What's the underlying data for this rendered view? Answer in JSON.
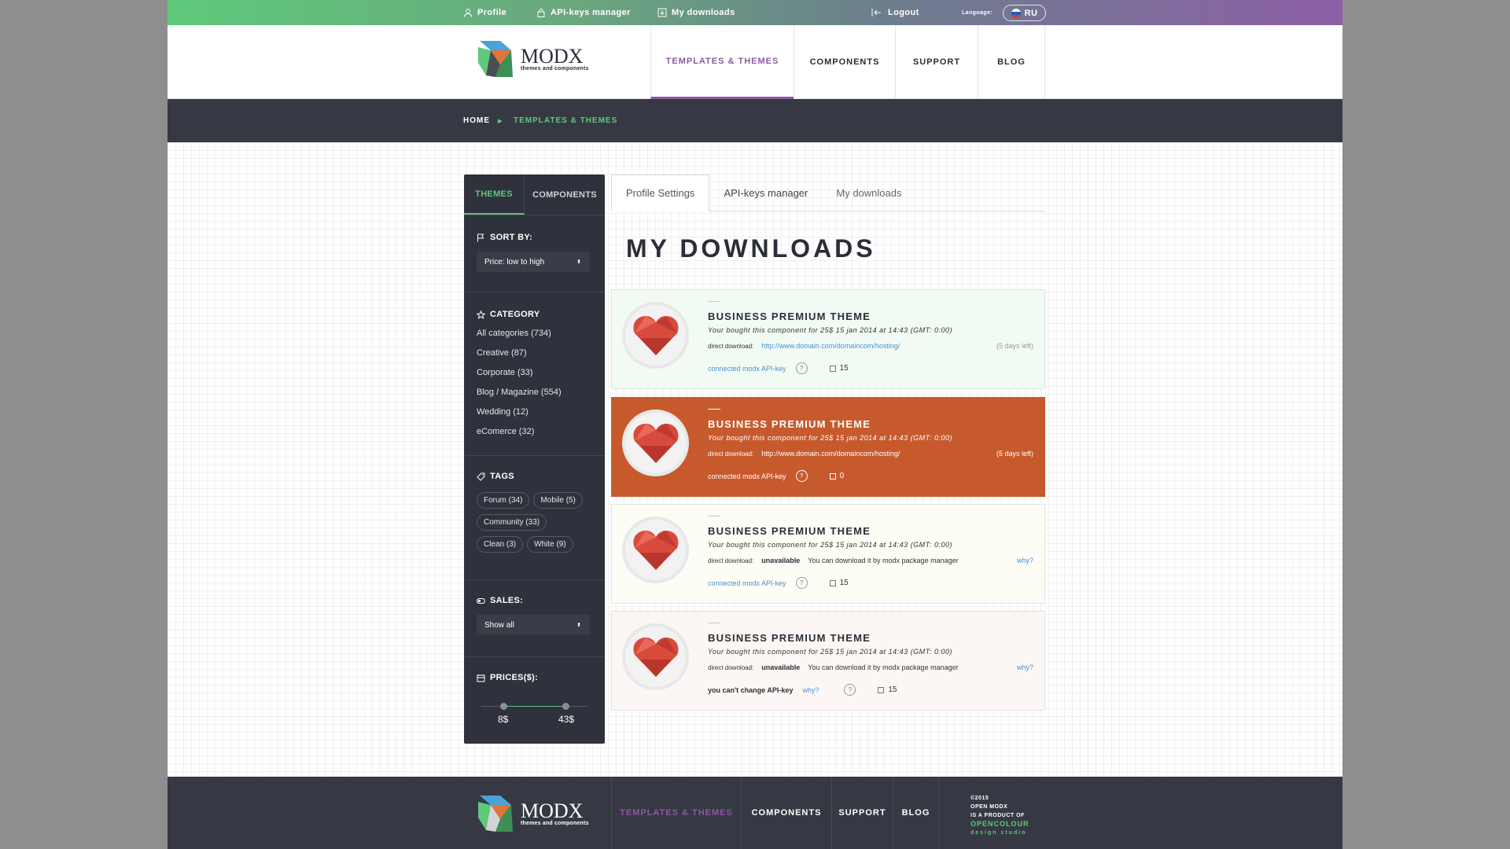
{
  "topbar": {
    "profile": "Profile",
    "api_keys": "API-keys manager",
    "downloads": "My downloads",
    "logout": "Logout",
    "language_label": "Language:",
    "language_value": "RU"
  },
  "logo": {
    "name": "MODX",
    "tagline": "themes and components"
  },
  "nav": [
    {
      "label": "TEMPLATES & THEMES",
      "active": true
    },
    {
      "label": "COMPONENTS"
    },
    {
      "label": "SUPPORT"
    },
    {
      "label": "BLOG"
    }
  ],
  "breadcrumb": {
    "home": "HOME",
    "current": "TEMPLATES & THEMES"
  },
  "sidebar": {
    "tabs": [
      "THEMES",
      "COMPONENTS"
    ],
    "sort_label": "SORT BY:",
    "sort_value": "Price: low to high",
    "category_label": "CATEGORY",
    "categories": [
      "All categories (734)",
      "Creative (87)",
      "Corporate (33)",
      "Blog / Magazine (554)",
      "Wedding (12)",
      "eComerce (32)"
    ],
    "tags_label": "TAGS",
    "tags": [
      "Forum (34)",
      "Mobile (5)",
      "Community (33)",
      "Clean (3)",
      "White (9)"
    ],
    "sales_label": "SALES:",
    "sales_value": "Show all",
    "prices_label": "PRICES($):",
    "price_min": "8$",
    "price_max": "43$"
  },
  "tabs": [
    "Profile Settings",
    "API-keys manager",
    "My downloads"
  ],
  "page_title": "MY DOWNLOADS",
  "downloads": [
    {
      "title": "BUSINESS PREMIUM THEME",
      "bought": "Your bought this component for 25$ 15 jan 2014 at 14:43 (GMT: 0:00)",
      "dl_label": "direct download:",
      "link": "http://www.domain.com/domaincom/hosting/",
      "days": "(5 days left)",
      "key": "connected modx API-key",
      "q": "?",
      "count": "15"
    },
    {
      "title": "BUSINESS PREMIUM THEME",
      "bought": "Your bought this component for 25$ 15 jan 2014 at 14:43 (GMT: 0:00)",
      "dl_label": "direct download:",
      "link": "http://www.domain.com/domaincom/hosting/",
      "days": "(5 days left)",
      "key": "connected modx API-key",
      "q": "?",
      "count": "0"
    },
    {
      "title": "BUSINESS PREMIUM THEME",
      "bought": "Your bought this component for 25$ 15 jan 2014 at 14:43 (GMT: 0:00)",
      "dl_label": "direct download:",
      "unavailable": "unavailable",
      "note": "You can download it by modx package manager",
      "why": "why?",
      "key": "connected modx API-key",
      "q": "?",
      "count": "15"
    },
    {
      "title": "BUSINESS PREMIUM THEME",
      "bought": "Your bought this component for 25$ 15 jan 2014 at 14:43 (GMT: 0:00)",
      "dl_label": "direct download:",
      "unavailable": "unavailable",
      "note": "You can download it by modx package manager",
      "why": "why?",
      "cant": "you can't change API-key",
      "why2": "why?",
      "q": "?",
      "count": "15"
    }
  ],
  "footer": {
    "nav": [
      "TEMPLATES & THEMES",
      "COMPONENTS",
      "SUPPORT",
      "BLOG"
    ],
    "copy1": "©2015",
    "copy2": "OPEN MODX",
    "copy3": "IS A PRODUCT OF",
    "brand": "OPENCOLOUR",
    "studio": "design studio"
  },
  "colors": {
    "accent_green": "#5ec97a",
    "accent_purple": "#8b5aa0",
    "dark": "#363944",
    "highlight": "#c75a2d"
  }
}
